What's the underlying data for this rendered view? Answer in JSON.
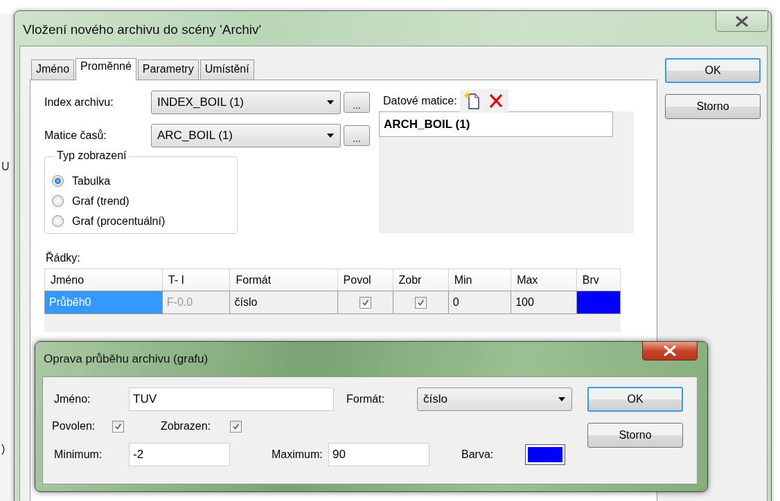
{
  "background_window": {
    "text_fragments": [
      "U",
      ")"
    ]
  },
  "main_dialog": {
    "title": "Vložení nového archivu do scény 'Archiv'",
    "tabs": [
      {
        "label": "Jméno",
        "selected": false
      },
      {
        "label": "Proměnné",
        "selected": true
      },
      {
        "label": "Parametry",
        "selected": false
      },
      {
        "label": "Umístění",
        "selected": false
      }
    ],
    "combos": [
      {
        "label": "Index archivu:",
        "value": "INDEX_BOIL (1)",
        "browse": "..."
      },
      {
        "label": "Matice časů:",
        "value": "ARC_BOIL (1)",
        "browse": "..."
      }
    ],
    "display_type": {
      "title": "Typ zobrazení",
      "options": [
        {
          "label": "Tabulka",
          "selected": true
        },
        {
          "label": "Graf (trend)",
          "selected": false
        },
        {
          "label": "Graf (procentuální)",
          "selected": false
        }
      ]
    },
    "data_matrices": {
      "label": "Datové matice:",
      "items": [
        {
          "label": "ARCH_BOIL (1)",
          "selected": true
        }
      ]
    },
    "rows_label": "Řádky:",
    "table": {
      "columns": [
        "Jméno",
        "T- I",
        "Formát",
        "Povol",
        "Zobr",
        "Min",
        "Max",
        "Brv"
      ],
      "rows": [
        {
          "name": "Průběh0",
          "t_i": "F-0.0",
          "format": "číslo",
          "enabled": true,
          "shown": true,
          "min": "0",
          "max": "100",
          "color": "#0000ff",
          "selected": true
        }
      ]
    },
    "buttons": [
      {
        "label": "OK",
        "default": true
      },
      {
        "label": "Storno",
        "default": false
      }
    ]
  },
  "edit_dialog": {
    "title": "Oprava průběhu archivu (grafu)",
    "name": {
      "label": "Jméno:",
      "value": "TUV"
    },
    "format": {
      "label": "Formát:",
      "value": "číslo"
    },
    "enabled": {
      "label": "Povolen:",
      "checked": true
    },
    "shown": {
      "label": "Zobrazen:",
      "checked": true
    },
    "minimum": {
      "label": "Minimum:",
      "value": "-2"
    },
    "maximum": {
      "label": "Maximum:",
      "value": "90"
    },
    "color": {
      "label": "Barva:",
      "color": "#0000ff"
    },
    "buttons": [
      {
        "label": "OK",
        "default": true
      },
      {
        "label": "Storno",
        "default": false
      }
    ]
  }
}
